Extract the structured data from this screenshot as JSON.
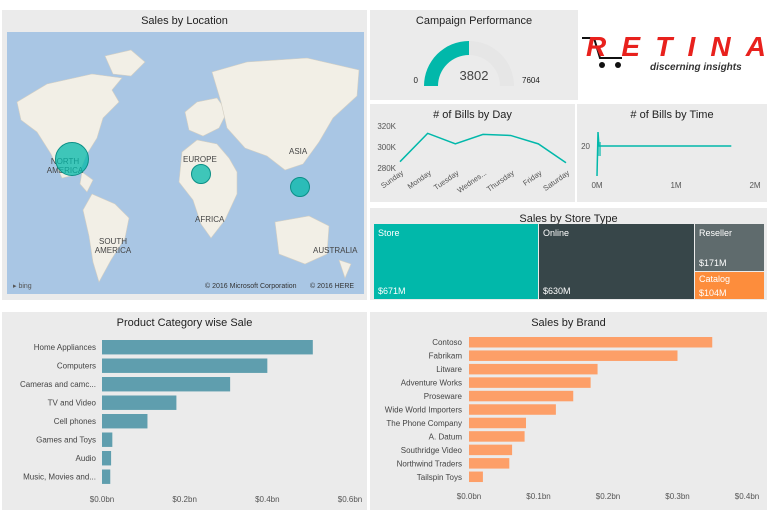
{
  "location": {
    "title": "Sales by Location",
    "labels": [
      "NORTH AMERICA",
      "EUROPE",
      "ASIA",
      "AFRICA",
      "SOUTH AMERICA",
      "AUSTRALIA"
    ],
    "copyright": "© 2016 Microsoft Corporation",
    "here": "© 2016 HERE",
    "bing": "bing"
  },
  "campaign": {
    "title": "Campaign Performance",
    "min": "0",
    "max": "7604",
    "value": "3802",
    "fill_fraction": 0.5
  },
  "logo": {
    "brand": "RETINA",
    "tagline": "discerning insights"
  },
  "colors": {
    "teal": "#01b8aa",
    "dark": "#374649",
    "slate": "#5f6b6d",
    "orange": "#fd8d3c",
    "steel": "#5f9eae",
    "bar_orange": "#fd9f68"
  },
  "bills_day": {
    "title": "# of Bills by Day",
    "chart_data": {
      "type": "line",
      "x": [
        "Sunday",
        "Monday",
        "Tuesday",
        "Wednes...",
        "Thursday",
        "Friday",
        "Saturday"
      ],
      "values": [
        286000,
        313000,
        303000,
        312000,
        311000,
        303000,
        285000
      ],
      "ylim": [
        280000,
        320000
      ],
      "yticks": [
        "320K",
        "300K",
        "280K"
      ]
    }
  },
  "bills_time": {
    "title": "# of Bills by Time",
    "chart_data": {
      "type": "line",
      "ytick": "20",
      "xticks": [
        "0M",
        "1M",
        "2M"
      ],
      "xlim": [
        0,
        2000000
      ],
      "plateau": 18,
      "end_x": 1700000
    }
  },
  "store_type": {
    "title": "Sales by Store Type",
    "chart_data": {
      "type": "treemap",
      "items": [
        {
          "name": "Store",
          "value_label": "$671M",
          "value": 671
        },
        {
          "name": "Online",
          "value_label": "$630M",
          "value": 630
        },
        {
          "name": "Reseller",
          "value_label": "$171M",
          "value": 171
        },
        {
          "name": "Catalog",
          "value_label": "$104M",
          "value": 104
        }
      ]
    }
  },
  "category": {
    "title": "Product Category wise Sale",
    "chart_data": {
      "type": "bar",
      "categories": [
        "Home Appliances",
        "Computers",
        "Cameras and camc...",
        "TV and Video",
        "Cell phones",
        "Games and Toys",
        "Audio",
        "Music, Movies and..."
      ],
      "values": [
        0.51,
        0.4,
        0.31,
        0.18,
        0.11,
        0.025,
        0.022,
        0.02
      ],
      "xlim": [
        0,
        0.6
      ],
      "xticks": [
        "$0.0bn",
        "$0.2bn",
        "$0.4bn",
        "$0.6bn"
      ]
    }
  },
  "brand": {
    "title": "Sales by Brand",
    "chart_data": {
      "type": "bar",
      "categories": [
        "Contoso",
        "Fabrikam",
        "Litware",
        "Adventure Works",
        "Proseware",
        "Wide World Importers",
        "The Phone Company",
        "A. Datum",
        "Southridge Video",
        "Northwind Traders",
        "Tailspin Toys"
      ],
      "values": [
        0.35,
        0.3,
        0.185,
        0.175,
        0.15,
        0.125,
        0.082,
        0.08,
        0.062,
        0.058,
        0.02
      ],
      "xlim": [
        0,
        0.4
      ],
      "xticks": [
        "$0.0bn",
        "$0.1bn",
        "$0.2bn",
        "$0.3bn",
        "$0.4bn"
      ]
    }
  }
}
